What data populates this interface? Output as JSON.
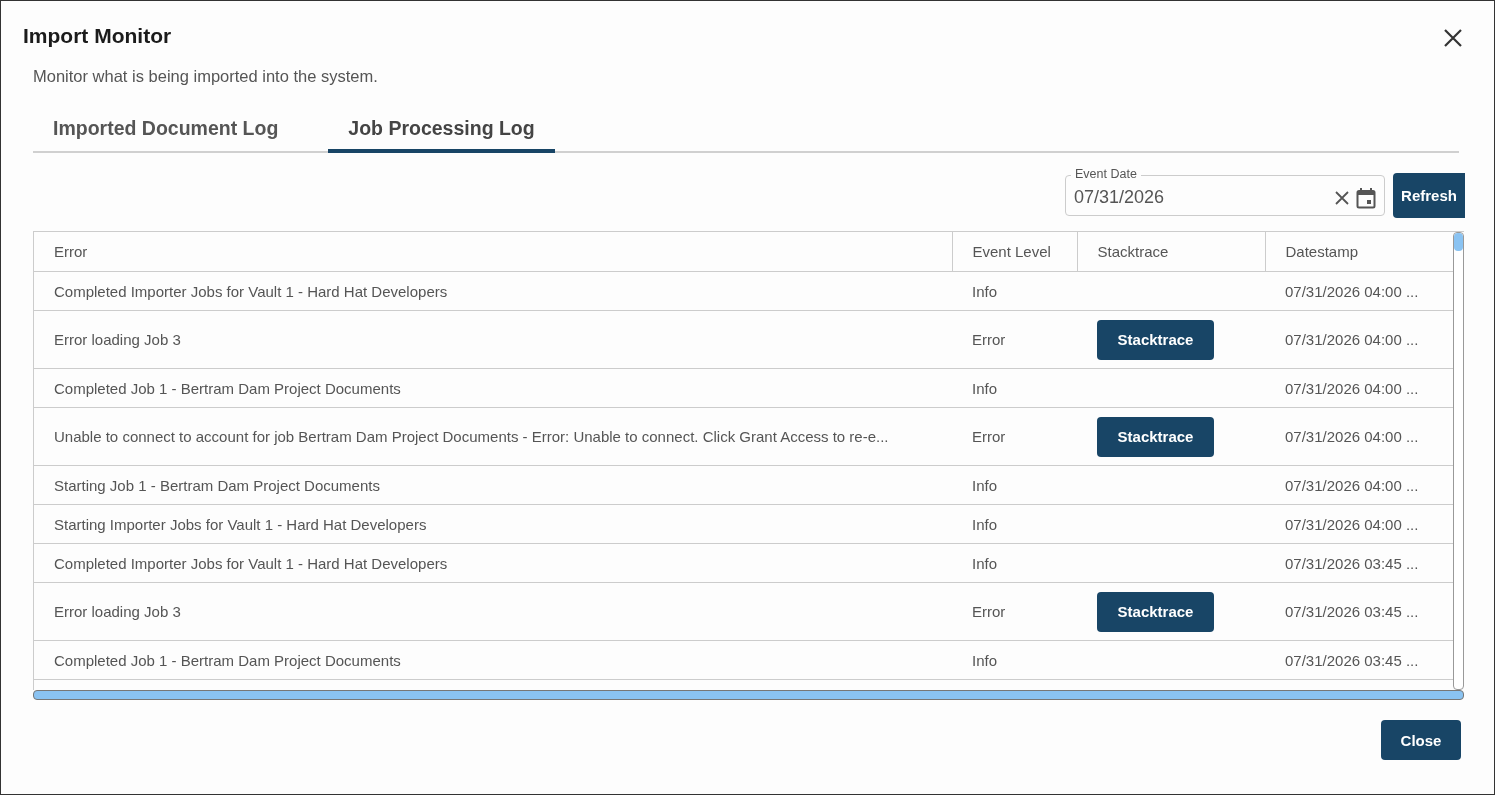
{
  "dialog": {
    "title": "Import Monitor",
    "subtitle": "Monitor what is being imported into the system.",
    "close_button": "Close"
  },
  "tabs": [
    {
      "label": "Imported Document Log",
      "selected": false
    },
    {
      "label": "Job Processing Log",
      "selected": true
    }
  ],
  "filter": {
    "label": "Event Date",
    "value": "07/31/2026",
    "refresh_button": "Refresh"
  },
  "table": {
    "columns": [
      "Error",
      "Event Level",
      "Stacktrace",
      "Datestamp"
    ],
    "rows": [
      {
        "error": "Completed Importer Jobs for Vault 1 - Hard Hat Developers",
        "level": "Info",
        "datestamp": "07/31/2026 04:00 ..."
      },
      {
        "error": "Error loading Job 3",
        "level": "Error",
        "stacktrace_button": "Stacktrace",
        "datestamp": "07/31/2026 04:00 ..."
      },
      {
        "error": "Completed Job 1 - Bertram Dam Project Documents",
        "level": "Info",
        "datestamp": "07/31/2026 04:00 ..."
      },
      {
        "error": "Unable to connect to account for job Bertram Dam Project Documents - Error: Unable to connect. Click Grant Access to re-e...",
        "level": "Error",
        "stacktrace_button": "Stacktrace",
        "datestamp": "07/31/2026 04:00 ..."
      },
      {
        "error": "Starting Job 1 - Bertram Dam Project Documents",
        "level": "Info",
        "datestamp": "07/31/2026 04:00 ..."
      },
      {
        "error": "Starting Importer Jobs for Vault 1 - Hard Hat Developers",
        "level": "Info",
        "datestamp": "07/31/2026 04:00 ..."
      },
      {
        "error": "Completed Importer Jobs for Vault 1 - Hard Hat Developers",
        "level": "Info",
        "datestamp": "07/31/2026 03:45 ..."
      },
      {
        "error": "Error loading Job 3",
        "level": "Error",
        "stacktrace_button": "Stacktrace",
        "datestamp": "07/31/2026 03:45 ..."
      },
      {
        "error": "Completed Job 1 - Bertram Dam Project Documents",
        "level": "Info",
        "datestamp": "07/31/2026 03:45 ..."
      }
    ]
  }
}
